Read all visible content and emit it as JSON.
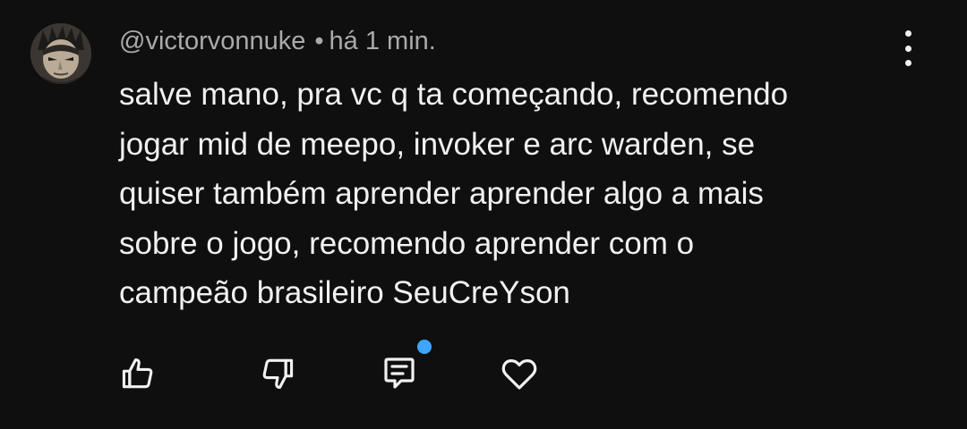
{
  "comment": {
    "author": "@victorvonnuke",
    "separator": "•",
    "time": "há 1 min.",
    "lines": [
      "salve mano, pra vc q ta começando, recomendo",
      "jogar mid de meepo, invoker e arc warden, se",
      "quiser também aprender aprender algo a mais",
      "sobre o jogo, recomendo aprender com o",
      "campeão brasileiro SeuCreYson"
    ]
  },
  "icons": {
    "avatar": "avatar-portrait",
    "more": "more-vertical-icon",
    "like": "thumbs-up-icon",
    "dislike": "thumbs-down-icon",
    "reply": "reply-comment-icon",
    "heart": "heart-icon"
  },
  "colors": {
    "background": "#0f0f0f",
    "text_primary": "#f1f1f1",
    "text_secondary": "#aaaaaa",
    "notification_dot": "#3ea6ff"
  }
}
